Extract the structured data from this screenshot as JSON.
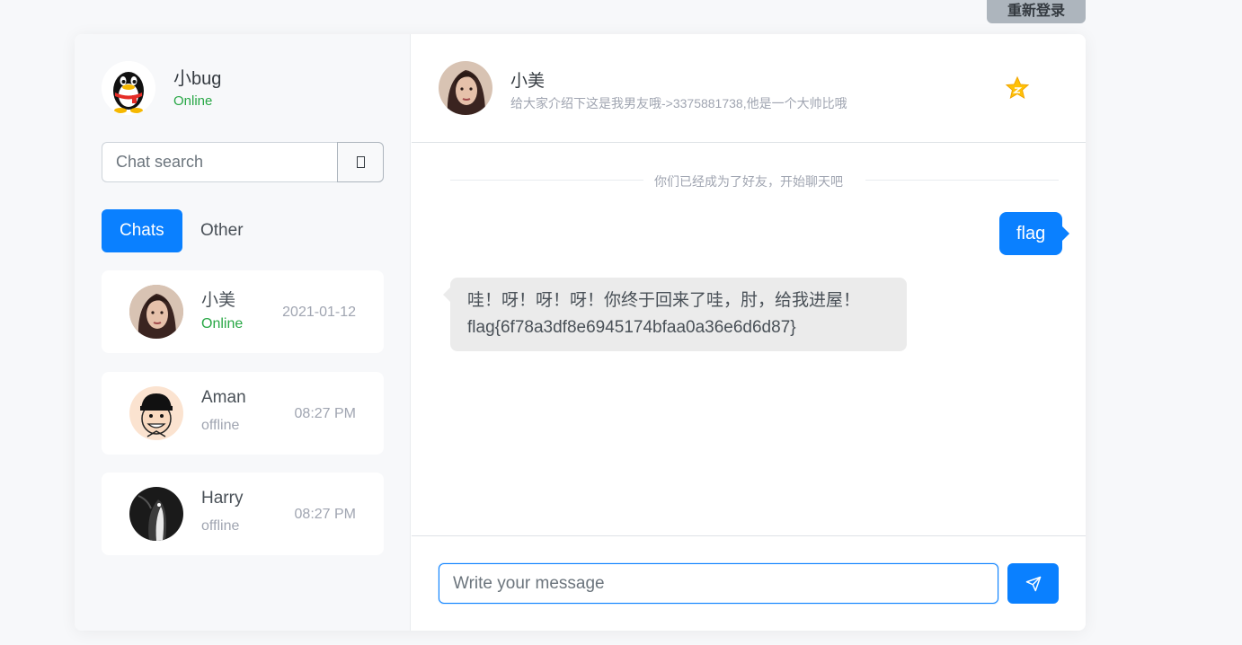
{
  "relogin": {
    "label": "重新登录"
  },
  "profile": {
    "name": "小bug",
    "status": "Online",
    "avatar_icon": "qq-penguin-avatar"
  },
  "search": {
    "placeholder": "Chat search",
    "button_icon": "square-glyph-icon"
  },
  "tabs": [
    {
      "label": "Chats",
      "active": true
    },
    {
      "label": "Other",
      "active": false
    }
  ],
  "chats": [
    {
      "name": "小美",
      "status": "Online",
      "time": "2021-01-12",
      "avatar_icon": "girl-avatar"
    },
    {
      "name": "Aman",
      "status": "offline",
      "time": "08:27 PM",
      "avatar_icon": "cartoon-boy-avatar"
    },
    {
      "name": "Harry",
      "status": "offline",
      "time": "08:27 PM",
      "avatar_icon": "penguin-photo-avatar"
    }
  ],
  "header": {
    "name": "小美",
    "subtitle": "给大家介绍下这是我男友哦->3375881738,他是一个大帅比哦",
    "favorite_icon": "star-icon"
  },
  "messages": {
    "system": "你们已经成为了好友，开始聊天吧",
    "outgoing": "flag",
    "incoming_line1": "哇！呀！呀！呀！你终于回来了哇，肘，给我进屋！",
    "incoming_line2": "flag{6f78a3df8e6945174bfaa0a36e6d6d87}"
  },
  "composer": {
    "placeholder": "Write your message",
    "send_icon": "send-icon"
  },
  "colors": {
    "accent": "#0a80ff",
    "online": "#28a745",
    "muted": "#a0a5b1",
    "star": "#ffc107"
  }
}
